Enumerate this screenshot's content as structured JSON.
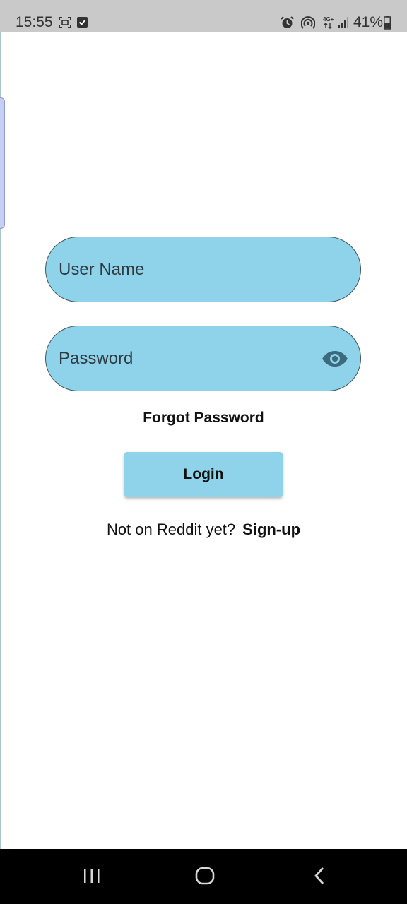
{
  "status_bar": {
    "time": "15:55",
    "left_icons": [
      "screenshot-icon",
      "checkbox-icon"
    ],
    "right_icons": [
      "alarm-icon",
      "hotspot-icon",
      "4g-data-icon",
      "signal-icon",
      "battery-icon"
    ],
    "battery_percent": "41%"
  },
  "form": {
    "username_placeholder": "User Name",
    "password_placeholder": "Password",
    "forgot_password": "Forgot Password",
    "login_label": "Login",
    "signup_prompt": "Not on Reddit yet?",
    "signup_link": "Sign-up"
  },
  "colors": {
    "field_bg": "#8fd3ea",
    "button_bg": "#8fd3ea",
    "eye_icon": "#3b6a7d"
  },
  "nav_bar": {
    "buttons": [
      "recent-apps-icon",
      "home-icon",
      "back-icon"
    ]
  }
}
